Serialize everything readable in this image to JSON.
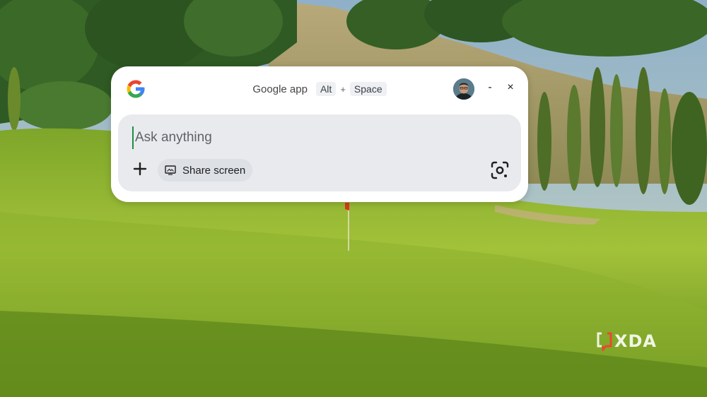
{
  "window": {
    "app_label": "Google app",
    "shortcut_keys": [
      "Alt",
      "Space"
    ],
    "shortcut_separator": "+",
    "minimize_label": "-",
    "close_label": "×"
  },
  "search": {
    "placeholder": "Ask anything",
    "value": ""
  },
  "actions": {
    "add_icon": "plus-icon",
    "share_screen_label": "Share screen",
    "share_screen_icon": "screen-icon",
    "lens_icon": "google-lens-icon"
  },
  "watermark": {
    "text": "XDA"
  },
  "colors": {
    "google_blue": "#4285F4",
    "google_red": "#EA4335",
    "google_yellow": "#FBBC05",
    "google_green": "#34A853",
    "cursor_green": "#1e8e3e"
  }
}
